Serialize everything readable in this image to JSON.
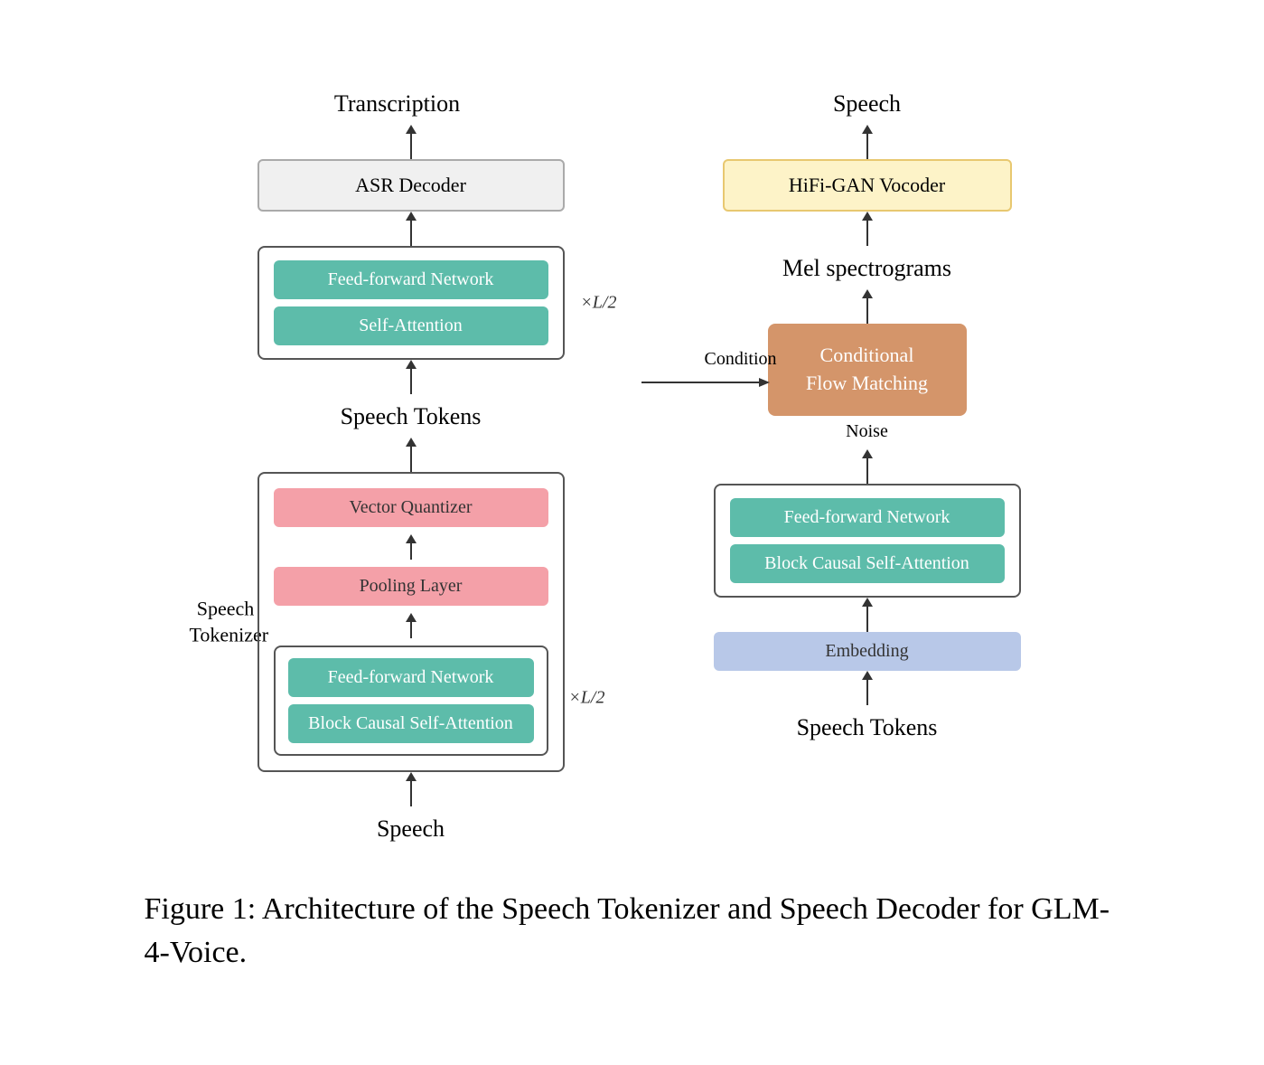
{
  "diagram": {
    "left": {
      "top_label": "Transcription",
      "asr_box": "ASR Decoder",
      "transformer_upper": {
        "box1": "Feed-forward Network",
        "box2": "Self-Attention",
        "multiplier": "×L/2"
      },
      "speech_tokens_label": "Speech Tokens",
      "speech_tokenizer_label": "Speech\nTokenizer",
      "speech_tokenizer_inner": {
        "box1": "Vector Quantizer",
        "box2": "Pooling Layer",
        "transformer": {
          "box1": "Feed-forward Network",
          "box2": "Block Causal Self-Attention",
          "multiplier": "×L/2"
        }
      },
      "bottom_label": "Speech"
    },
    "right": {
      "top_label": "Speech",
      "hifigan_box": "HiFi-GAN Vocoder",
      "mel_label": "Mel spectrograms",
      "condition_label": "Condition",
      "cfm_box": "Conditional\nFlow Matching",
      "noise_label": "Noise",
      "decoder_block": {
        "box1": "Feed-forward Network",
        "box2": "Block Causal Self-Attention"
      },
      "embedding_box": "Embedding",
      "bottom_label": "Speech Tokens"
    }
  },
  "caption": "Figure 1:  Architecture of the Speech Tokenizer and Speech Decoder for GLM-4-Voice."
}
